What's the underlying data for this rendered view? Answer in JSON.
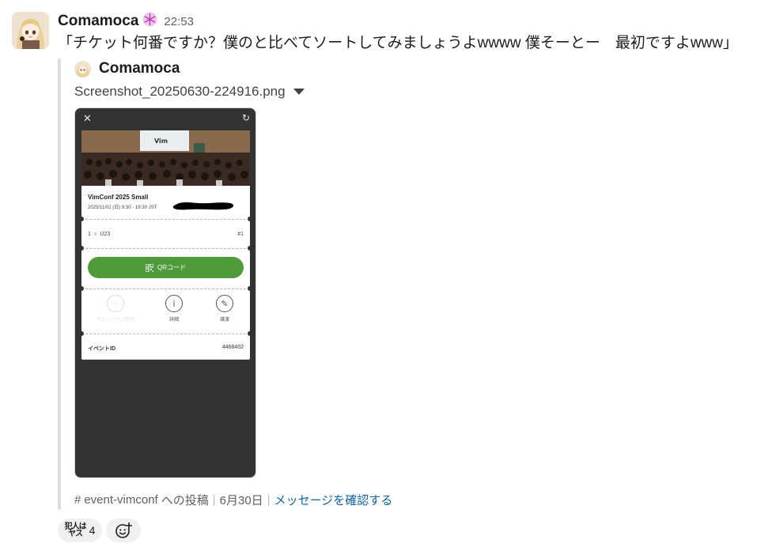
{
  "message": {
    "username": "Comamoca",
    "status_emoji": "snowflake-pink-icon",
    "timestamp": "22:53",
    "text": "「チケット何番ですか？僕のと比べてソートしてみましょうよwwww 僕そーとー　最初ですよwww」"
  },
  "attachment": {
    "author": "Comamoca",
    "file_name": "Screenshot_20250630-224916.png",
    "screenshot": {
      "close_icon": "close-icon",
      "refresh_icon": "refresh-icon",
      "event_title": "VimConf 2025 Small",
      "event_date": "2025/11/02 (日) 9:30 - 19:30 JST",
      "ticket_qty": "1",
      "ticket_x": "x",
      "ticket_type": "U23",
      "ticket_number": "#1",
      "qr_label": "QRコード",
      "actions": [
        {
          "label": "チェックイン受付",
          "icon": "hand-tap-icon",
          "enabled": false
        },
        {
          "label": "詳細",
          "icon": "info-icon",
          "enabled": true
        },
        {
          "label": "譲渡",
          "icon": "ticket-transfer-icon",
          "enabled": true
        }
      ],
      "event_id_label": "イベントID",
      "event_id_value": "4468402"
    }
  },
  "footer": {
    "hash": "#",
    "channel": "event-vimconf",
    "posted_suffix": "への投稿",
    "date": "6月30日",
    "link": "メッセージを確認する"
  },
  "reactions": [
    {
      "emoji_text_top": "犯人は",
      "emoji_text_bottom": "ヤス",
      "count": "4"
    }
  ],
  "add_reaction_icon": "add-reaction-icon",
  "colors": {
    "text": "#1d1c1d",
    "muted": "#616061",
    "link": "#1264a3",
    "qr_button": "#4f9a3b",
    "phone_bg": "#333333",
    "quote_bar": "#dddddd",
    "reaction_bg": "#f0f0f0"
  }
}
